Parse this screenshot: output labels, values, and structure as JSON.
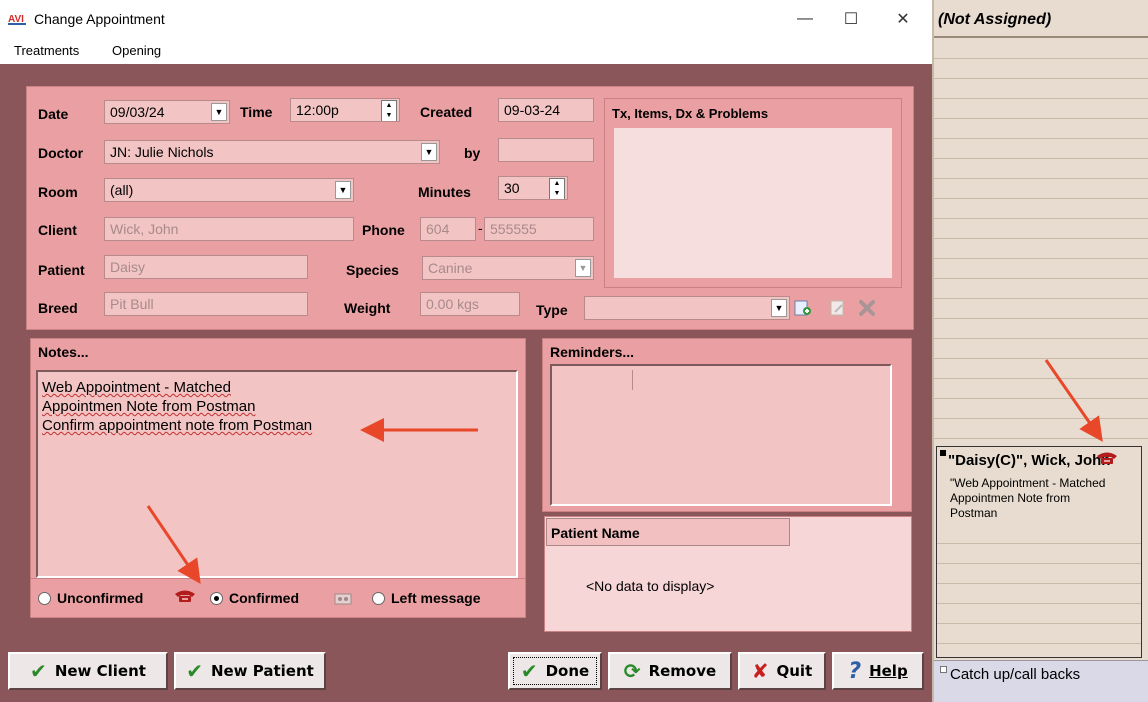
{
  "window": {
    "title": "Change Appointment",
    "logo_text": "AVI",
    "minimize": "—",
    "maximize": "☐",
    "close": "✕"
  },
  "menu": [
    "Treatments",
    "Opening"
  ],
  "form": {
    "date_label": "Date",
    "date_value": "09/03/24",
    "time_label": "Time",
    "time_value": "12:00p",
    "created_label": "Created",
    "created_value": "09-03-24",
    "doctor_label": "Doctor",
    "doctor_value": "JN: Julie Nichols",
    "by_label": "by",
    "by_value": "",
    "room_label": "Room",
    "room_value": "(all)",
    "minutes_label": "Minutes",
    "minutes_value": "30",
    "client_label": "Client",
    "client_value": "Wick, John",
    "phone_label": "Phone",
    "phone_area": "604",
    "phone_number": "555555",
    "patient_label": "Patient",
    "patient_value": "Daisy",
    "species_label": "Species",
    "species_value": "Canine",
    "breed_label": "Breed",
    "breed_value": "Pit Bull",
    "weight_label": "Weight",
    "weight_value": "0.00 kgs",
    "type_label": "Type",
    "type_value": ""
  },
  "tx_panel": {
    "title": "Tx, Items, Dx & Problems"
  },
  "notes": {
    "title": "Notes...",
    "lines": [
      "Web Appointment - Matched",
      "Appointmen Note from Postman",
      "Confirm appointment note from Postman"
    ]
  },
  "reminders": {
    "title": "Reminders..."
  },
  "patient_name": {
    "header": "Patient Name",
    "empty": "<No data to display>"
  },
  "status": {
    "options": [
      "Unconfirmed",
      "Confirmed",
      "Left message"
    ],
    "selected": "Confirmed"
  },
  "buttons": {
    "new_client": "New Client",
    "new_patient": "New Patient",
    "done": "Done",
    "remove": "Remove",
    "quit": "Quit",
    "help": "Help"
  },
  "schedule": {
    "header": "(Not Assigned)",
    "appointment_title": "\"Daisy(C)\", Wick, John",
    "appointment_note_lines": [
      "\"Web Appointment - Matched",
      "Appointmen Note from",
      "Postman"
    ],
    "footer": "Catch up/call backs"
  },
  "colors": {
    "dialog_bg": "#8b5659",
    "panel_bg": "#eaa0a2",
    "field_bg": "#f3c4c4",
    "schedule_bg": "#e8dcd0",
    "annotation_arrow": "#e8472a"
  }
}
